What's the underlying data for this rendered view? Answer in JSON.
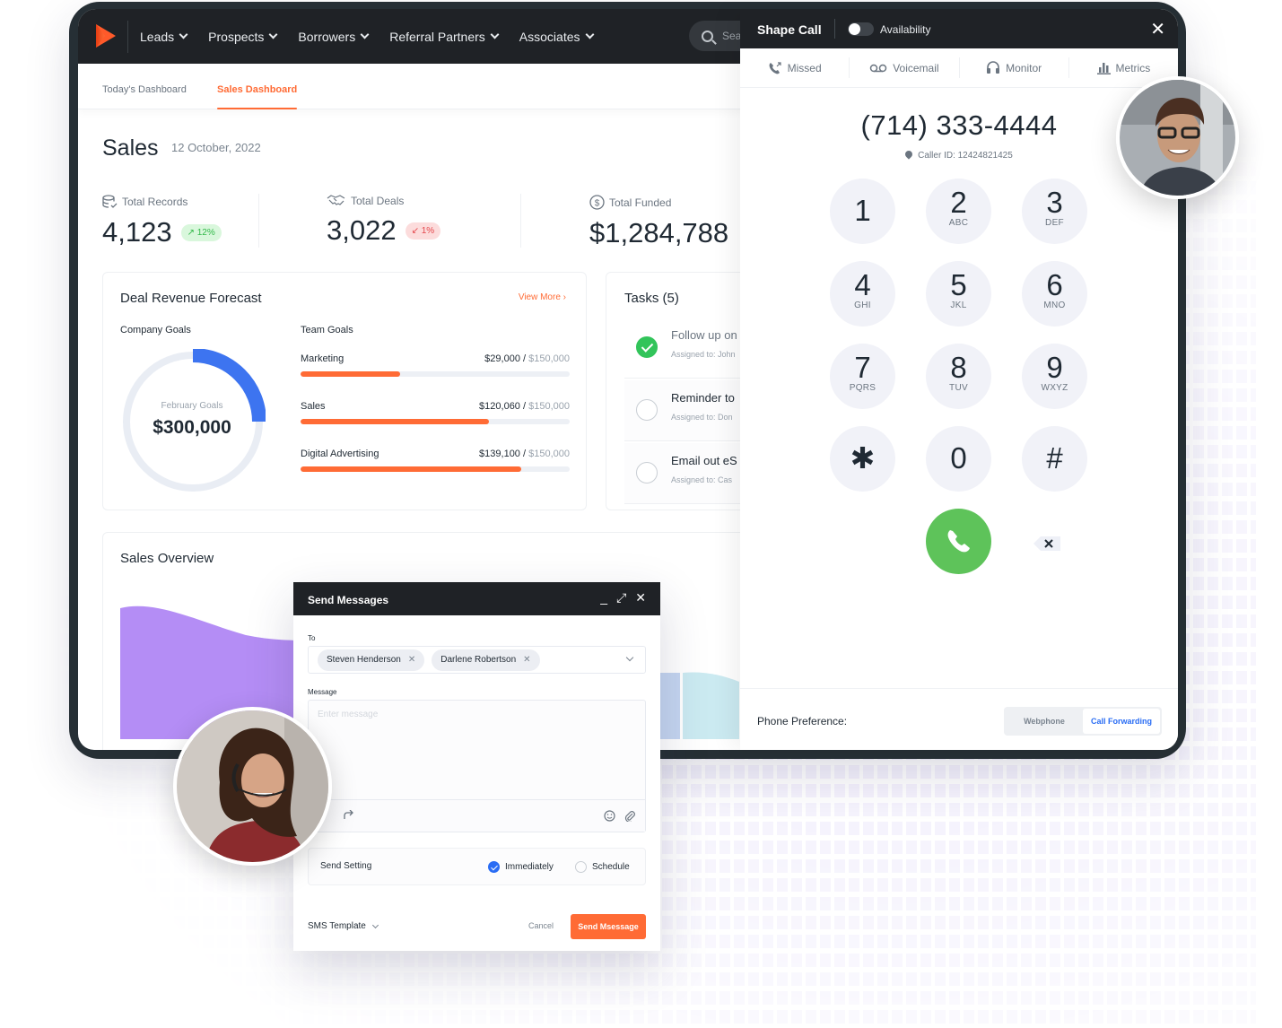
{
  "nav": {
    "items": [
      {
        "label": "Leads"
      },
      {
        "label": "Prospects"
      },
      {
        "label": "Borrowers"
      },
      {
        "label": "Referral Partners"
      },
      {
        "label": "Associates"
      }
    ],
    "search_placeholder": "Search"
  },
  "subtabs": [
    {
      "label": "Today's Dashboard",
      "active": false
    },
    {
      "label": "Sales Dashboard",
      "active": true
    }
  ],
  "page": {
    "title": "Sales",
    "date": "12 October, 2022"
  },
  "stats": [
    {
      "label": "Total Records",
      "icon": "database-check-icon",
      "value": "4,123",
      "change": "12%",
      "direction": "up"
    },
    {
      "label": "Total Deals",
      "icon": "handshake-icon",
      "value": "3,022",
      "change": "1%",
      "direction": "down"
    },
    {
      "label": "Total Funded",
      "icon": "dollar-circle-icon",
      "value": "$1,284,788"
    }
  ],
  "forecast": {
    "title": "Deal Revenue Forecast",
    "view_more": "View More",
    "company_goals_label": "Company Goals",
    "team_goals_label": "Team Goals",
    "donut_caption": "February Goals",
    "donut_value": "$300,000",
    "donut_progress": 0.25,
    "team_goals": [
      {
        "name": "Marketing",
        "current": "$29,000",
        "max": "$150,000",
        "progress": 0.37
      },
      {
        "name": "Sales",
        "current": "$120,060",
        "max": "$150,000",
        "progress": 0.7
      },
      {
        "name": "Digital Advertising",
        "current": "$139,100",
        "max": "$150,000",
        "progress": 0.82
      }
    ]
  },
  "tasks": {
    "title": "Tasks (5)",
    "items": [
      {
        "title": "Follow up on",
        "assigned": "Assigned to: John",
        "done": true
      },
      {
        "title": "Reminder to",
        "assigned": "Assigned to: Don",
        "done": false
      },
      {
        "title": "Email out eS",
        "assigned": "Assigned to: Cas",
        "done": false
      }
    ]
  },
  "overview": {
    "title": "Sales Overview"
  },
  "call": {
    "title": "Shape Call",
    "availability": "Availability",
    "availability_on": false,
    "tabs": [
      {
        "label": "Missed",
        "icon": "missed-call-icon"
      },
      {
        "label": "Voicemail",
        "icon": "voicemail-icon"
      },
      {
        "label": "Monitor",
        "icon": "headset-icon"
      },
      {
        "label": "Metrics",
        "icon": "bar-chart-icon"
      }
    ],
    "number": "(714) 333-4444",
    "caller_id": "Caller ID: 12424821425",
    "keys": [
      {
        "digit": "1",
        "letters": ""
      },
      {
        "digit": "2",
        "letters": "ABC"
      },
      {
        "digit": "3",
        "letters": "DEF"
      },
      {
        "digit": "4",
        "letters": "GHI"
      },
      {
        "digit": "5",
        "letters": "JKL"
      },
      {
        "digit": "6",
        "letters": "MNO"
      },
      {
        "digit": "7",
        "letters": "PQRS"
      },
      {
        "digit": "8",
        "letters": "TUV"
      },
      {
        "digit": "9",
        "letters": "WXYZ"
      },
      {
        "digit": "✱",
        "letters": ""
      },
      {
        "digit": "0",
        "letters": ""
      },
      {
        "digit": "#",
        "letters": ""
      }
    ],
    "phone_pref_label": "Phone Preference:",
    "pref_options": [
      "Webphone",
      "Call Forwarding"
    ],
    "pref_selected": "Call Forwarding",
    "accent": "#2a6df4",
    "call_color": "#5ec35a"
  },
  "messages": {
    "title": "Send Messages",
    "to_label": "To",
    "recipients": [
      "Steven Henderson",
      "Darlene Robertson"
    ],
    "message_label": "Message",
    "message_placeholder": "Enter message",
    "send_setting_label": "Send Setting",
    "options": [
      {
        "label": "Immediately",
        "checked": true
      },
      {
        "label": "Schedule",
        "checked": false
      }
    ],
    "template_label": "SMS Template",
    "cancel": "Cancel",
    "send": "Send Msessage"
  },
  "colors": {
    "brand": "#ff6b35",
    "dark": "#1f2226",
    "blue": "#2a6df4",
    "green": "#32c45a"
  }
}
